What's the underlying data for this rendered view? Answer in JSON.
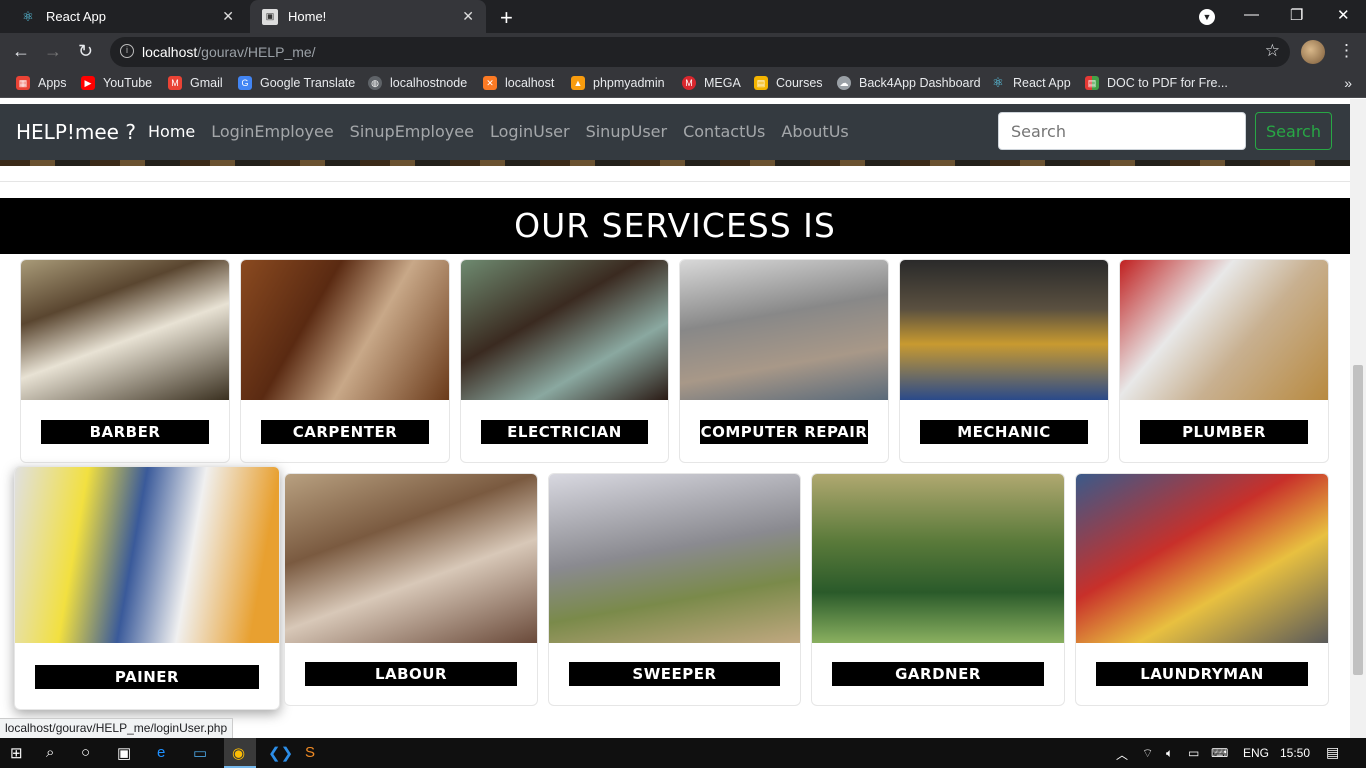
{
  "browser": {
    "tabs": [
      {
        "title": "React App",
        "active": false
      },
      {
        "title": "Home!",
        "active": true
      }
    ],
    "address": {
      "host": "localhost",
      "path": "/gourav/HELP_me/"
    },
    "bookmarks": [
      {
        "label": "Apps",
        "icon": "apps-grid-icon",
        "color": "#ea4335"
      },
      {
        "label": "YouTube",
        "icon": "youtube-icon",
        "color": "#ff0000"
      },
      {
        "label": "Gmail",
        "icon": "gmail-icon",
        "color": "#ea4335"
      },
      {
        "label": "Google Translate",
        "icon": "translate-icon",
        "color": "#4285f4"
      },
      {
        "label": "localhostnode",
        "icon": "globe-icon",
        "color": "#5f6368"
      },
      {
        "label": "localhost",
        "icon": "xampp-icon",
        "color": "#fb7a24"
      },
      {
        "label": "phpmyadmin",
        "icon": "phpmyadmin-icon",
        "color": "#f89c0e"
      },
      {
        "label": "MEGA",
        "icon": "mega-icon",
        "color": "#d9272e"
      },
      {
        "label": "Courses",
        "icon": "courses-icon",
        "color": "#f4b400"
      },
      {
        "label": "Back4App Dashboard",
        "icon": "back4app-icon",
        "color": "#9aa0a6"
      },
      {
        "label": "React App",
        "icon": "react-icon",
        "color": "#61dafb"
      },
      {
        "label": "DOC to PDF for Fre...",
        "icon": "doc-pdf-icon",
        "color": "#e53935"
      }
    ]
  },
  "site": {
    "brand": "HELP!mee ?",
    "nav": [
      "Home",
      "LoginEmployee",
      "SinupEmployee",
      "LoginUser",
      "SinupUser",
      "ContactUs",
      "AboutUs"
    ],
    "search_placeholder": "Search",
    "search_button": "Search",
    "services_title": "OUR SERVICESS IS",
    "services_row1": [
      "BARBER",
      "CARPENTER",
      "ELECTRICIAN",
      "COMPUTER REPAIR",
      "MECHANIC",
      "PLUMBER"
    ],
    "services_row2": [
      "PAINER",
      "LABOUR",
      "SWEEPER",
      "GARDNER",
      "LAUNDRYMAN"
    ]
  },
  "status_url": "localhost/gourav/HELP_me/loginUser.php",
  "taskbar": {
    "language": "ENG",
    "time": "15:50"
  },
  "colors": {
    "navbar_bg": "#343a40",
    "search_accent": "#28a745",
    "header_bg": "#000000"
  }
}
